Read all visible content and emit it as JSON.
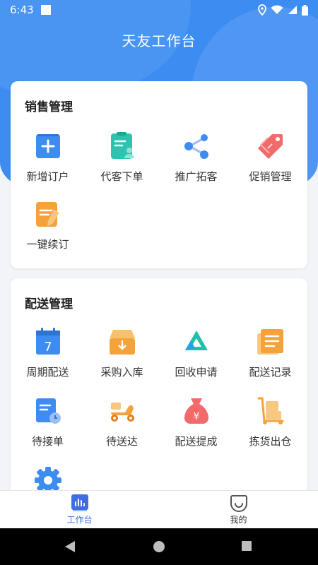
{
  "status": {
    "time": "6:43"
  },
  "header": {
    "title": "天友工作台"
  },
  "sales": {
    "title": "销售管理",
    "items": [
      {
        "label": "新增订户",
        "icon": "plus-square-icon"
      },
      {
        "label": "代客下单",
        "icon": "user-document-icon"
      },
      {
        "label": "推广拓客",
        "icon": "share-icon"
      },
      {
        "label": "促销管理",
        "icon": "price-tag-icon"
      },
      {
        "label": "一键续订",
        "icon": "edit-document-icon"
      }
    ]
  },
  "delivery": {
    "title": "配送管理",
    "items": [
      {
        "label": "周期配送",
        "icon": "calendar-icon"
      },
      {
        "label": "采购入库",
        "icon": "inbound-box-icon"
      },
      {
        "label": "回收申请",
        "icon": "recycle-triangle-icon"
      },
      {
        "label": "配送记录",
        "icon": "record-list-icon"
      },
      {
        "label": "待接单",
        "icon": "clock-document-icon"
      },
      {
        "label": "待送达",
        "icon": "scooter-icon"
      },
      {
        "label": "配送提成",
        "icon": "money-bag-icon"
      },
      {
        "label": "拣货出仓",
        "icon": "hand-truck-icon"
      },
      {
        "label": "",
        "icon": "gear-icon"
      }
    ]
  },
  "tabs": [
    {
      "label": "工作台",
      "icon": "bar-chart-icon",
      "active": true
    },
    {
      "label": "我的",
      "icon": "smile-icon",
      "active": false
    }
  ],
  "colors": {
    "primary": "#3d8cf2",
    "active_tab": "#3d6fe0",
    "background": "#f3f4f8"
  }
}
